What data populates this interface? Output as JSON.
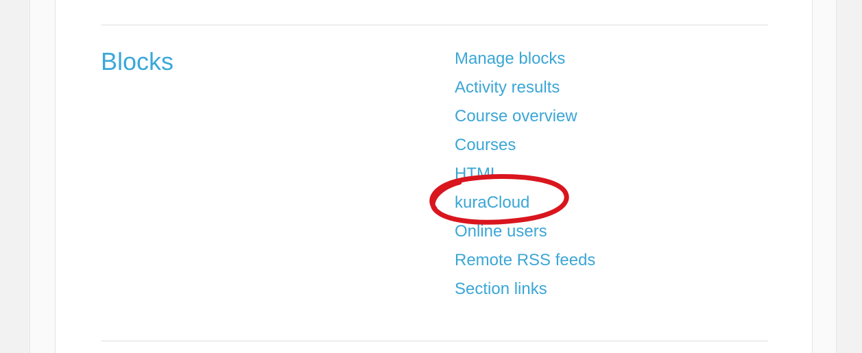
{
  "section": {
    "title": "Blocks"
  },
  "links": [
    {
      "label": "Manage blocks"
    },
    {
      "label": "Activity results"
    },
    {
      "label": "Course overview"
    },
    {
      "label": "Courses"
    },
    {
      "label": "HTML"
    },
    {
      "label": "kuraCloud"
    },
    {
      "label": "Online users"
    },
    {
      "label": "Remote RSS feeds"
    },
    {
      "label": "Section links"
    }
  ],
  "colors": {
    "link": "#3ba6d6",
    "heading": "#3aa8d8",
    "annotation": "#d9151e"
  }
}
